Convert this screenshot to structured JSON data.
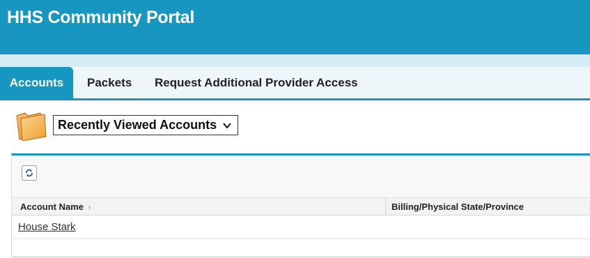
{
  "header": {
    "title": "HHS Community Portal"
  },
  "tabs": [
    {
      "label": "Accounts",
      "active": true
    },
    {
      "label": "Packets",
      "active": false
    },
    {
      "label": "Request Additional Provider Access",
      "active": false
    }
  ],
  "view": {
    "folder_icon": "folder-icon",
    "selected": "Recently Viewed Accounts",
    "chevron_icon": "chevron-down-icon"
  },
  "list": {
    "refresh_icon": "refresh-icon",
    "columns": [
      {
        "label": "Account Name",
        "sort_indicator": "↑"
      },
      {
        "label": "Billing/Physical State/Province"
      }
    ],
    "rows": [
      {
        "account_name": "House Stark",
        "state": ""
      }
    ]
  },
  "colors": {
    "brand": "#1797c0",
    "tab_band": "#eef6f9",
    "sub_band": "#d6ecf4"
  }
}
